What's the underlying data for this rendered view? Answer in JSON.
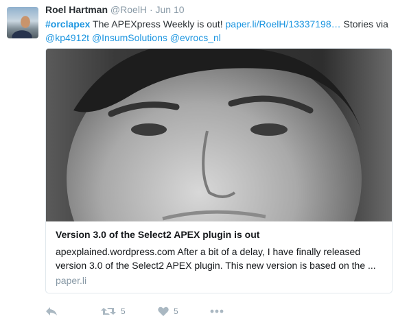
{
  "tweet": {
    "author_name": "Roel Hartman",
    "handle": "@RoelH",
    "separator": "·",
    "date": "Jun 10",
    "hashtag": "#orclapex",
    "text_1": " The APEXpress Weekly is out! ",
    "link": "paper.li/RoelH/13337198…",
    "text_2": " Stories via ",
    "mention_1": "@kp4912t",
    "mention_2": "@InsumSolutions",
    "mention_3": "@evrocs_nl"
  },
  "card": {
    "title": "Version 3.0 of the Select2 APEX plugin is out",
    "description": "apexplained.wordpress.com After a bit of a delay, I have finally released version 3.0 of the Select2 APEX plugin. This new version is based on the ...",
    "domain": "paper.li"
  },
  "actions": {
    "reply_icon": "reply-icon",
    "retweet_icon": "retweet-icon",
    "retweet_count": "5",
    "like_icon": "heart-icon",
    "like_count": "5",
    "more_icon": "more-icon"
  },
  "colors": {
    "link": "#1b95e0",
    "muted": "#8899a6",
    "icon": "#aab8c2",
    "text": "#292f33"
  }
}
